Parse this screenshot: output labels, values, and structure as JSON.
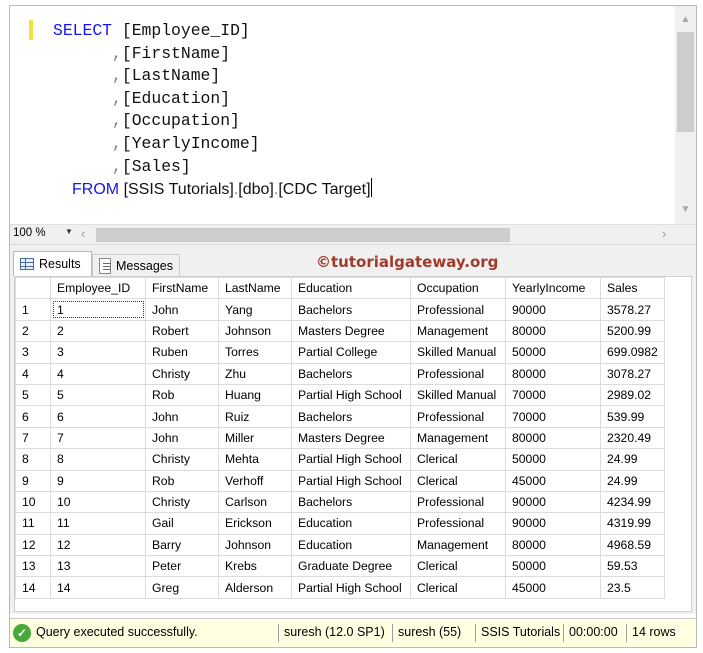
{
  "editor": {
    "lines": [
      {
        "kw": "SELECT",
        "pre": "",
        "ident": "[Employee_ID]"
      },
      {
        "kw": "",
        "pre": "      ,",
        "ident": "[FirstName]"
      },
      {
        "kw": "",
        "pre": "      ,",
        "ident": "[LastName]"
      },
      {
        "kw": "",
        "pre": "      ,",
        "ident": "[Education]"
      },
      {
        "kw": "",
        "pre": "      ,",
        "ident": "[Occupation]"
      },
      {
        "kw": "",
        "pre": "      ,",
        "ident": "[YearlyIncome]"
      },
      {
        "kw": "",
        "pre": "      ,",
        "ident": "[Sales]"
      }
    ],
    "from_kw": "FROM",
    "from_db": "[SSIS Tutorials]",
    "dot": ".",
    "from_schema": "[dbo]",
    "from_table": "[CDC Target]"
  },
  "zoom": {
    "value": "100 %"
  },
  "tabs": {
    "results": "Results",
    "messages": "Messages"
  },
  "watermark": "©tutorialgateway.org",
  "grid": {
    "columns": [
      "Employee_ID",
      "FirstName",
      "LastName",
      "Education",
      "Occupation",
      "YearlyIncome",
      "Sales"
    ],
    "rows": [
      [
        "1",
        "1",
        "John",
        "Yang",
        "Bachelors",
        "Professional",
        "90000",
        "3578.27"
      ],
      [
        "2",
        "2",
        "Robert",
        "Johnson",
        "Masters Degree",
        "Management",
        "80000",
        "5200.99"
      ],
      [
        "3",
        "3",
        "Ruben",
        "Torres",
        "Partial College",
        "Skilled Manual",
        "50000",
        "699.0982"
      ],
      [
        "4",
        "4",
        "Christy",
        "Zhu",
        "Bachelors",
        "Professional",
        "80000",
        "3078.27"
      ],
      [
        "5",
        "5",
        "Rob",
        "Huang",
        "Partial High School",
        "Skilled Manual",
        "70000",
        "2989.02"
      ],
      [
        "6",
        "6",
        "John",
        "Ruiz",
        "Bachelors",
        "Professional",
        "70000",
        "539.99"
      ],
      [
        "7",
        "7",
        "John",
        "Miller",
        "Masters Degree",
        "Management",
        "80000",
        "2320.49"
      ],
      [
        "8",
        "8",
        "Christy",
        "Mehta",
        "Partial High School",
        "Clerical",
        "50000",
        "24.99"
      ],
      [
        "9",
        "9",
        "Rob",
        "Verhoff",
        "Partial High School",
        "Clerical",
        "45000",
        "24.99"
      ],
      [
        "10",
        "10",
        "Christy",
        "Carlson",
        "Bachelors",
        "Professional",
        "90000",
        "4234.99"
      ],
      [
        "11",
        "11",
        "Gail",
        "Erickson",
        "Education",
        "Professional",
        "90000",
        "4319.99"
      ],
      [
        "12",
        "12",
        "Barry",
        "Johnson",
        "Education",
        "Management",
        "80000",
        "4968.59"
      ],
      [
        "13",
        "13",
        "Peter",
        "Krebs",
        "Graduate Degree",
        "Clerical",
        "50000",
        "59.53"
      ],
      [
        "14",
        "14",
        "Greg",
        "Alderson",
        "Partial High School",
        "Clerical",
        "45000",
        "23.5"
      ]
    ]
  },
  "status": {
    "message": "Query executed successfully.",
    "server": "suresh (12.0 SP1)",
    "user": "suresh (55)",
    "database": "SSIS Tutorials",
    "elapsed": "00:00:00",
    "rows": "14 rows"
  },
  "icons": {
    "ok": "check-circle-icon",
    "grid": "grid-icon",
    "messages": "message-icon"
  }
}
